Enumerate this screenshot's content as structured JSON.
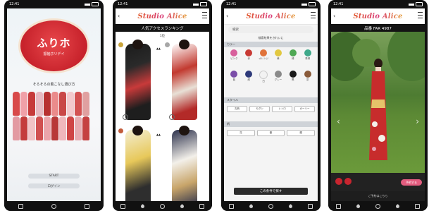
{
  "status_bar": {
    "time": "12:41"
  },
  "screen1": {
    "logo_title": "ふりホ",
    "logo_subtitle": "振袖ホリデイ",
    "tagline": "そろそろの着こなし選び方",
    "start_button": "START",
    "second_button": "ログイン"
  },
  "screen2": {
    "brand": "Studio Alice",
    "section_title": "人気アクセスランキング",
    "top_label": "1位"
  },
  "screen3": {
    "brand": "Studio Alice",
    "search_placeholder": "検索",
    "filter_caption": "検索結果をきれいに",
    "color_section": "カラー",
    "colors": [
      {
        "name": "ピンク",
        "hex": "#d8609c"
      },
      {
        "name": "赤",
        "hex": "#c83a34"
      },
      {
        "name": "オレンジ",
        "hex": "#e0733a"
      },
      {
        "name": "黄",
        "hex": "#e2c840"
      },
      {
        "name": "緑",
        "hex": "#4fa854"
      },
      {
        "name": "青緑",
        "hex": "#3fa88a"
      },
      {
        "name": "紫",
        "hex": "#7b4ea8"
      },
      {
        "name": "紺",
        "hex": "#2e3a7a"
      },
      {
        "name": "白",
        "hex": "#f2f2f2"
      },
      {
        "name": "グレー",
        "hex": "#8a8a8a"
      },
      {
        "name": "黒",
        "hex": "#1a1a1a"
      },
      {
        "name": "茶",
        "hex": "#8a5b3a"
      }
    ],
    "style_section": "スタイル",
    "style_chips": [
      "古典",
      "モダン",
      "レトロ",
      "ガーリー"
    ],
    "pattern_section": "柄",
    "pattern_chips": [
      "花",
      "鶴",
      "蝶"
    ],
    "submit_button": "この条件で探す"
  },
  "screen4": {
    "brand": "Studio Alice",
    "item_code": "品番 FAR 4987",
    "reserve_button": "予約する",
    "footer": "ご予約はこちら"
  }
}
